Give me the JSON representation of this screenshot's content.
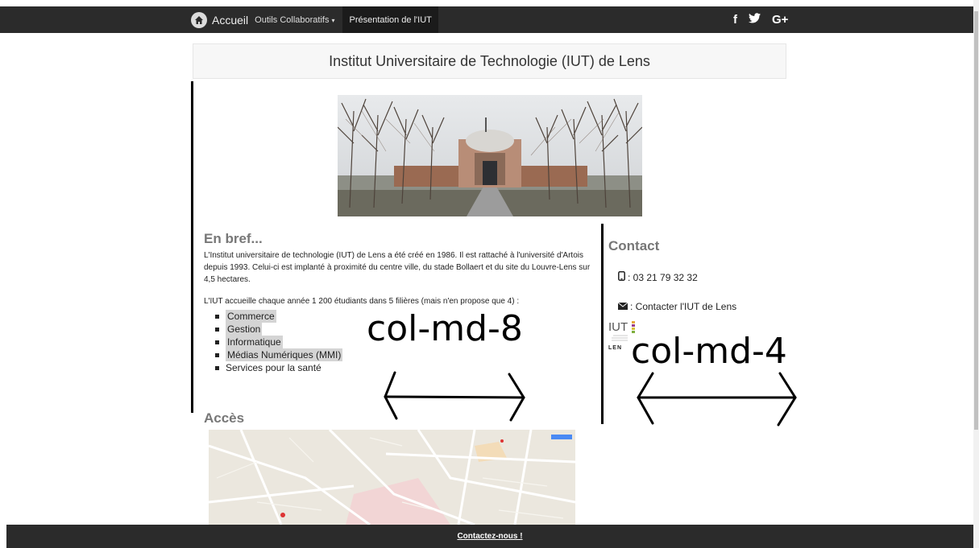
{
  "nav": {
    "brand": "Accueil",
    "tools_menu": "Outils Collaboratifs",
    "presentation": "Présentation de l'IUT"
  },
  "social": {
    "facebook": "f",
    "twitter": "❛",
    "google": "G+"
  },
  "header": {
    "title": "Institut Universitaire de Technologie (IUT) de Lens"
  },
  "bref": {
    "heading": "En bref...",
    "para1": "L'Institut universitaire de technologie (IUT) de Lens a été créé en 1986. Il est rattaché à l'université d'Artois depuis 1993. Celui-ci est implanté à proximité du centre ville, du stade Bollaert et du site du Louvre-Lens sur 4,5 hectares.",
    "para2": "L'IUT accueille chaque année 1 200 étudiants dans 5 filières (mais n'en propose que 4) :",
    "items": [
      "Commerce",
      "Gestion",
      "Informatique",
      "Médias Numériques (MMI)",
      "Services pour la santé"
    ]
  },
  "acces": {
    "heading": "Accès"
  },
  "contact": {
    "heading": "Contact",
    "phone": ": 03 21 79 32 32",
    "mail": ": Contacter l'IUT de Lens",
    "logo_text": "IUT",
    "logo_sub": "LEN"
  },
  "annotations": {
    "left": "col-md-8",
    "right": "col-md-4"
  },
  "footer": {
    "link": "Contactez-nous !"
  }
}
